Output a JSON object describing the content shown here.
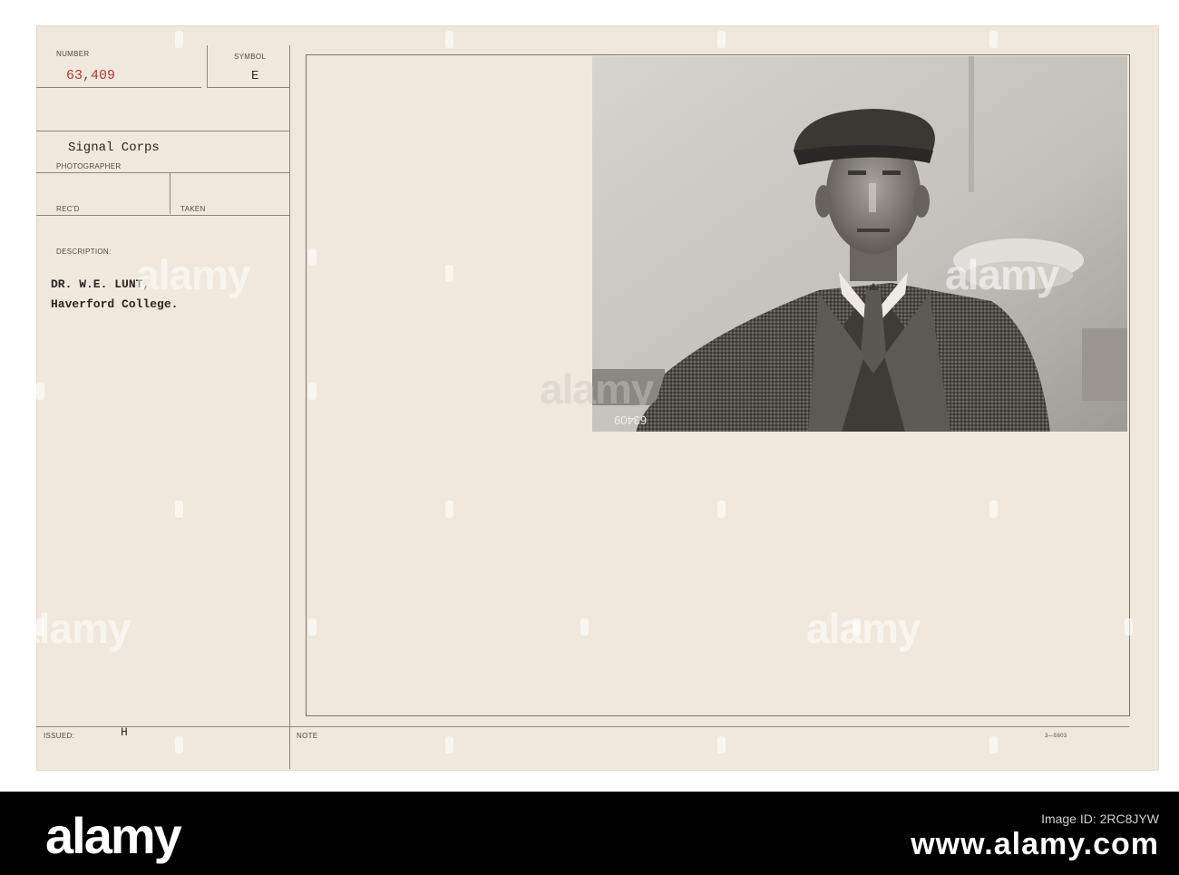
{
  "record": {
    "number_label": "NUMBER",
    "number_value": "63,409",
    "symbol_label": "SYMBOL",
    "symbol_value": "E",
    "photographer_value": "Signal Corps",
    "photographer_label": "PHOTOGRAPHER",
    "recd_label": "REC'D",
    "taken_label": "TAKEN",
    "description_label": "DESCRIPTION:",
    "description_line1": "DR. W.E. LUNT,",
    "description_line2": "Haverford College.",
    "issued_label": "ISSUED:",
    "issued_value": "H",
    "note_label": "NOTE",
    "form_code": "3—5603"
  },
  "photo": {
    "negative_number": "63409",
    "subject": "man-in-flat-cap-portrait"
  },
  "watermark": {
    "text": "alamy"
  },
  "footer": {
    "logo": "alamy",
    "image_id_label": "Image ID: 2RC8JYW",
    "image_id_value": "www.alamy.com"
  },
  "colors": {
    "card": "#f0e8dc",
    "rule": "#8f867b",
    "stamp_red": "#b03a3e",
    "typewriter": "#2a2623",
    "footer_bg": "#000000"
  }
}
